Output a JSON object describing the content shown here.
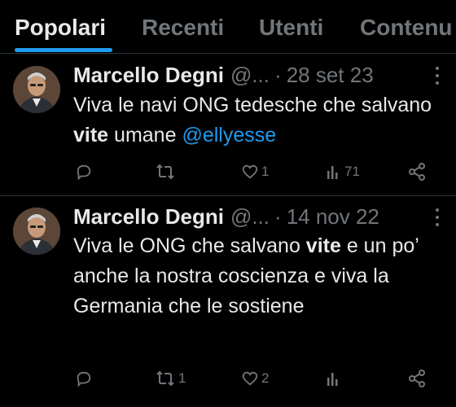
{
  "tabs": [
    {
      "label": "Popolari",
      "active": true
    },
    {
      "label": "Recenti",
      "active": false
    },
    {
      "label": "Utenti",
      "active": false
    },
    {
      "label": "Contenu",
      "active": false
    }
  ],
  "tweets": [
    {
      "name": "Marcello Degni",
      "handle": "@...",
      "dot": "·",
      "date": "28 set 23",
      "text_parts": [
        "Viva le navi ONG tedesche che salvano ",
        "vite",
        " umane "
      ],
      "mention": "@ellyesse",
      "replies": "",
      "retweets": "",
      "likes": "1",
      "views": "71"
    },
    {
      "name": "Marcello Degni",
      "handle": "@...",
      "dot": "·",
      "date": "14 nov 22",
      "text_parts": [
        "Viva le ONG che salvano ",
        "vite",
        " e un po’ anche la nostra coscienza e viva la Germania che le sostiene"
      ],
      "replies": "",
      "retweets": "1",
      "likes": "2",
      "views": ""
    }
  ],
  "colors": {
    "background": "#000000",
    "text": "#e7e9ea",
    "muted": "#71767b",
    "accent": "#1d9bf0",
    "divider": "#2f3336"
  },
  "icons": [
    "reply-icon",
    "retweet-icon",
    "like-icon",
    "views-icon",
    "share-icon",
    "more-icon"
  ]
}
